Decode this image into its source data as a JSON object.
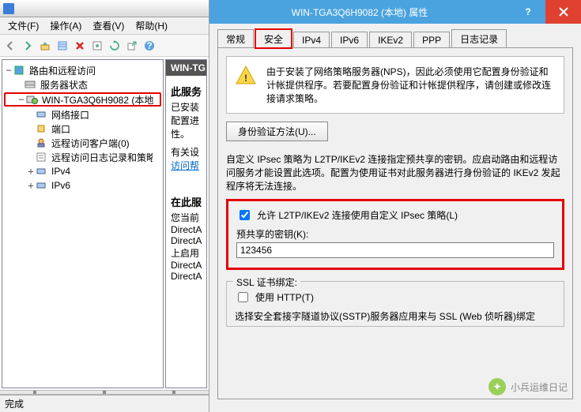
{
  "mmc": {
    "menu": {
      "file": "文件(F)",
      "action": "操作(A)",
      "view": "查看(V)",
      "help": "帮助(H)"
    },
    "tree": {
      "root": "路由和远程访问",
      "server_status": "服务器状态",
      "server_node": "WIN-TGA3Q6H9082 (本地",
      "net_if": "网络接口",
      "ports": "端口",
      "ras_clients": "远程访问客户端(0)",
      "ras_log": "远程访问日志记录和策略",
      "ipv4": "IPv4",
      "ipv6": "IPv6"
    },
    "right": {
      "title_prefix": "WIN-TG",
      "h1": "此服务",
      "l1": "已安装",
      "l2": "配置进",
      "l3": "性。",
      "l4": "有关设",
      "link": "访问帮",
      "h2": "在此服",
      "c1": "您当前",
      "c2": "DirectA",
      "c3": "DirectA",
      "c4": "上启用",
      "c5": "DirectA",
      "c6": "DirectA"
    },
    "status": "完成"
  },
  "props": {
    "title": "WIN-TGA3Q6H9082 (本地) 属性",
    "tabs": {
      "general": "常规",
      "security": "安全",
      "ipv4": "IPv4",
      "ipv6": "IPv6",
      "ikev2": "IKEv2",
      "ppp": "PPP",
      "logging": "日志记录"
    },
    "info_text": "由于安装了网络策略服务器(NPS)，因此必须使用它配置身份验证和计帐提供程序。若要配置身份验证和计帐提供程序，请创建或修改连接请求策略。",
    "auth_btn": "身份验证方法(U)...",
    "ipsec_desc": "自定义 IPsec 策略为 L2TP/IKEv2 连接指定预共享的密钥。应启动路由和远程访问服务才能设置此选项。配置为使用证书对此服务器进行身份验证的 IKEv2 发起程序将无法连接。",
    "chk_label": "允许 L2TP/IKEv2 连接使用自定义 IPsec 策略(L)",
    "psk_label": "预共享的密钥(K):",
    "psk_value": "123456",
    "ssl_legend": "SSL 证书绑定:",
    "use_http": "使用 HTTP(T)",
    "ssl_desc": "选择安全套接字隧道协议(SSTP)服务器应用来与 SSL (Web 侦听器)绑定",
    "watermark": "小兵运维日记"
  }
}
